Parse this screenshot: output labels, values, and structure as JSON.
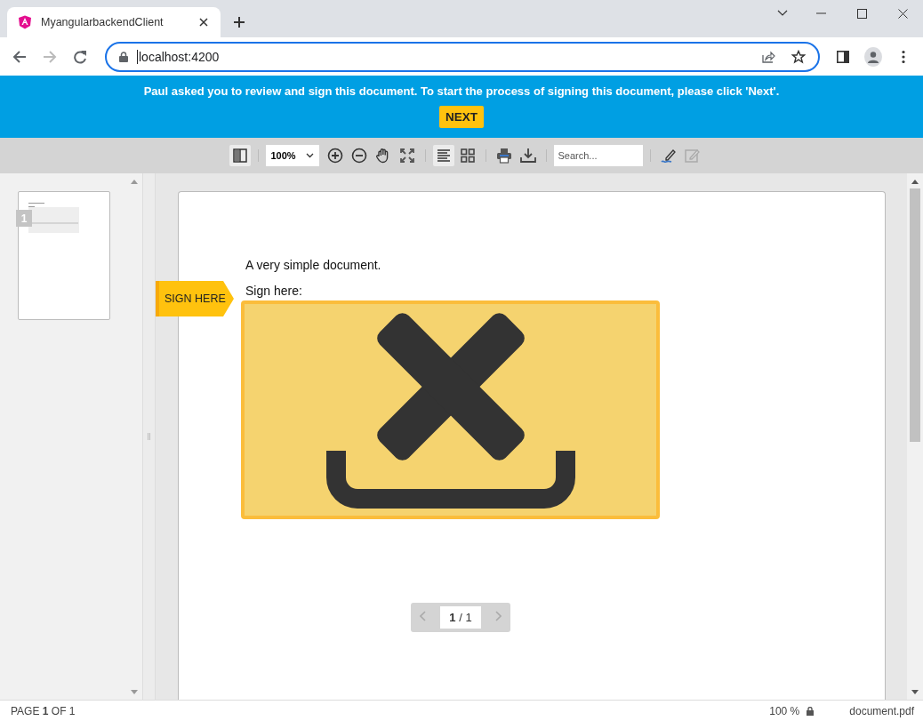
{
  "browser": {
    "tabs": [
      {
        "title": "MyangularbackendClient",
        "selected": true
      }
    ],
    "address": "localhost:4200"
  },
  "banner": {
    "message": "Paul asked you to review and sign this document. To start the process of signing this document, please click 'Next'.",
    "button": "NEXT"
  },
  "viewer_toolbar": {
    "tools": [
      {
        "kind": "sidebar",
        "selected": true
      },
      {
        "kind": "separator"
      },
      {
        "kind": "zoom-select",
        "value": "100%"
      },
      {
        "kind": "zoom-in"
      },
      {
        "kind": "zoom-out"
      },
      {
        "kind": "pan"
      },
      {
        "kind": "fit"
      },
      {
        "kind": "separator"
      },
      {
        "kind": "single-page",
        "selected": true
      },
      {
        "kind": "grid",
        "selected": false
      },
      {
        "kind": "separator"
      },
      {
        "kind": "print"
      },
      {
        "kind": "download"
      },
      {
        "kind": "separator"
      },
      {
        "kind": "search",
        "placeholder": "Search..."
      },
      {
        "kind": "separator"
      },
      {
        "kind": "sign"
      },
      {
        "kind": "edit-disabled"
      }
    ]
  },
  "thumbnails": [
    {
      "page": "1"
    }
  ],
  "document": {
    "lines": [
      "A very simple document.",
      "Sign here:"
    ],
    "signature_field": {
      "flag": "SIGN HERE"
    }
  },
  "page_nav": {
    "text": "**1** / 1"
  },
  "status_bar": {
    "page": "PAGE **1** OF 1",
    "zoom": "100 %",
    "file": "document.pdf"
  }
}
